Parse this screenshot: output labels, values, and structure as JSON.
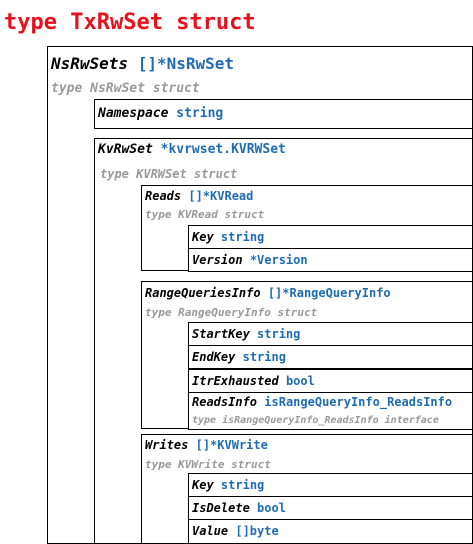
{
  "title": "type TxRwSet struct",
  "nsrwsets": {
    "name": "NsRwSets",
    "type": "[]*NsRwSet",
    "struct": "type NsRwSet struct"
  },
  "namespace": {
    "name": "Namespace",
    "type": "string"
  },
  "kvrwset": {
    "name": "KvRwSet",
    "type": "*kvrwset.KVRWSet",
    "struct": "type KVRWSet struct"
  },
  "reads": {
    "name": "Reads",
    "type": "[]*KVRead",
    "struct": "type KVRead struct",
    "fields": [
      {
        "name": "Key",
        "type": "string"
      },
      {
        "name": "Version",
        "type": "*Version"
      }
    ]
  },
  "rangequeries": {
    "name": "RangeQueriesInfo",
    "type": "[]*RangeQueryInfo",
    "struct": "type RangeQueryInfo struct",
    "fields": [
      {
        "name": "StartKey",
        "type": "string"
      },
      {
        "name": "EndKey",
        "type": "string"
      },
      {
        "name": "ItrExhausted",
        "type": "bool"
      },
      {
        "name": "ReadsInfo",
        "type": "isRangeQueryInfo_ReadsInfo",
        "sub": "type isRangeQueryInfo_ReadsInfo interface"
      }
    ]
  },
  "writes": {
    "name": "Writes",
    "type": "[]*KVWrite",
    "struct": "type KVWrite struct",
    "fields": [
      {
        "name": "Key",
        "type": "string"
      },
      {
        "name": "IsDelete",
        "type": "bool"
      },
      {
        "name": "Value",
        "type": "[]byte"
      }
    ]
  }
}
